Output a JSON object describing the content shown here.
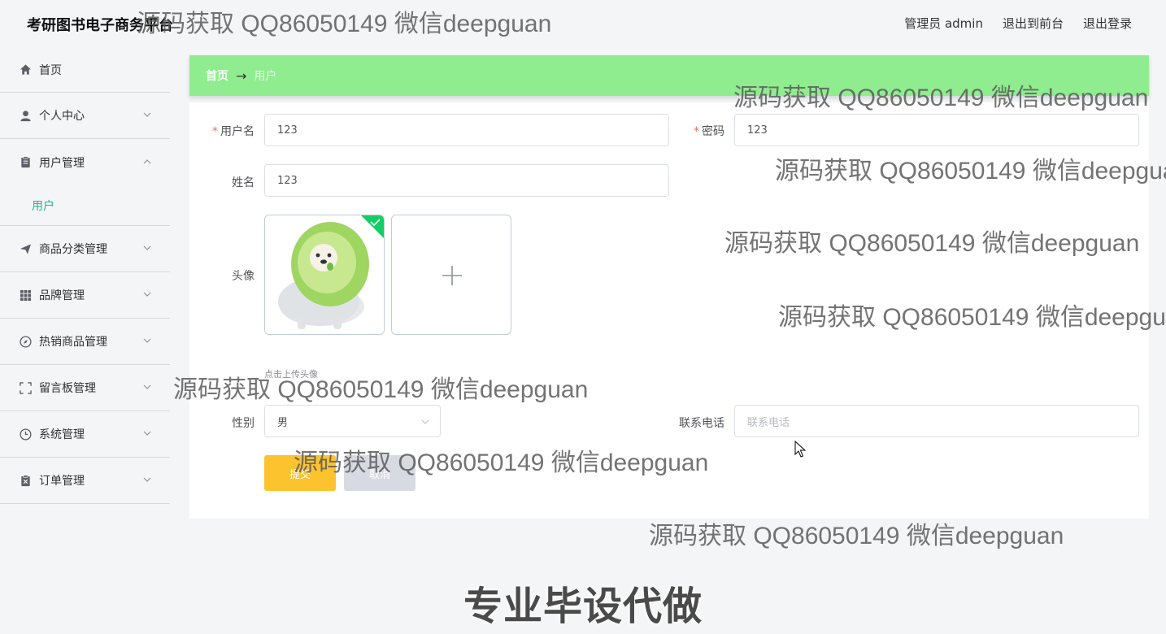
{
  "app": {
    "title": "考研图书电子商务平台"
  },
  "header": {
    "user": "管理员 admin",
    "front": "退出到前台",
    "logout": "退出登录"
  },
  "sidebar": {
    "items": [
      {
        "label": "首页",
        "icon": "home-icon"
      },
      {
        "label": "个人中心",
        "icon": "user-icon"
      },
      {
        "label": "用户管理",
        "icon": "clipboard-icon",
        "sub": "用户"
      },
      {
        "label": "商品分类管理",
        "icon": "send-icon"
      },
      {
        "label": "品牌管理",
        "icon": "grid-icon"
      },
      {
        "label": "热销商品管理",
        "icon": "compass-icon"
      },
      {
        "label": "留言板管理",
        "icon": "fullscreen-icon"
      },
      {
        "label": "系统管理",
        "icon": "clock-icon"
      },
      {
        "label": "订单管理",
        "icon": "delete-doc-icon"
      }
    ]
  },
  "breadcrumb": {
    "home": "首页",
    "separator": "→",
    "current": "用户"
  },
  "form": {
    "username_label": "用户名",
    "username_value": "123",
    "password_label": "密码",
    "password_value": "123",
    "name_label": "姓名",
    "name_value": "123",
    "avatar_label": "头像",
    "avatar_hint": "点击上传头像",
    "gender_label": "性别",
    "gender_value": "男",
    "phone_label": "联系电话",
    "phone_placeholder": "联系电话",
    "submit_label": "提交",
    "cancel_label": "取消"
  },
  "watermarks": {
    "text": "源码获取 QQ86050149 微信deepguan",
    "promo": "专业毕设代做"
  },
  "colors": {
    "accent": "#26b398",
    "breadcrumb_bg": "#8fed8f",
    "submit": "#fdc32f",
    "cancel": "#d7dbe1"
  }
}
